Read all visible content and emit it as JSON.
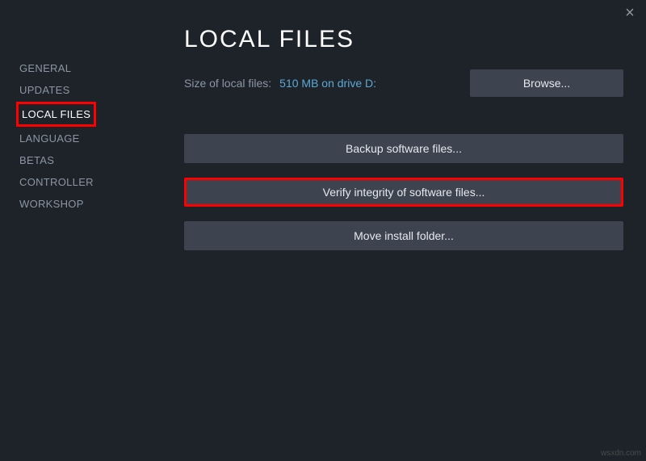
{
  "close_label": "×",
  "sidebar": {
    "items": [
      {
        "label": "GENERAL",
        "active": false,
        "highlight": false
      },
      {
        "label": "UPDATES",
        "active": false,
        "highlight": false
      },
      {
        "label": "LOCAL FILES",
        "active": true,
        "highlight": true
      },
      {
        "label": "LANGUAGE",
        "active": false,
        "highlight": false
      },
      {
        "label": "BETAS",
        "active": false,
        "highlight": false
      },
      {
        "label": "CONTROLLER",
        "active": false,
        "highlight": false
      },
      {
        "label": "WORKSHOP",
        "active": false,
        "highlight": false
      }
    ]
  },
  "main": {
    "title": "LOCAL FILES",
    "size_label": "Size of local files:",
    "size_value": "510 MB on drive D:",
    "browse_label": "Browse...",
    "buttons": [
      {
        "label": "Backup software files...",
        "highlight": false
      },
      {
        "label": "Verify integrity of software files...",
        "highlight": true
      },
      {
        "label": "Move install folder...",
        "highlight": false
      }
    ]
  },
  "watermark": "wsxdn.com"
}
